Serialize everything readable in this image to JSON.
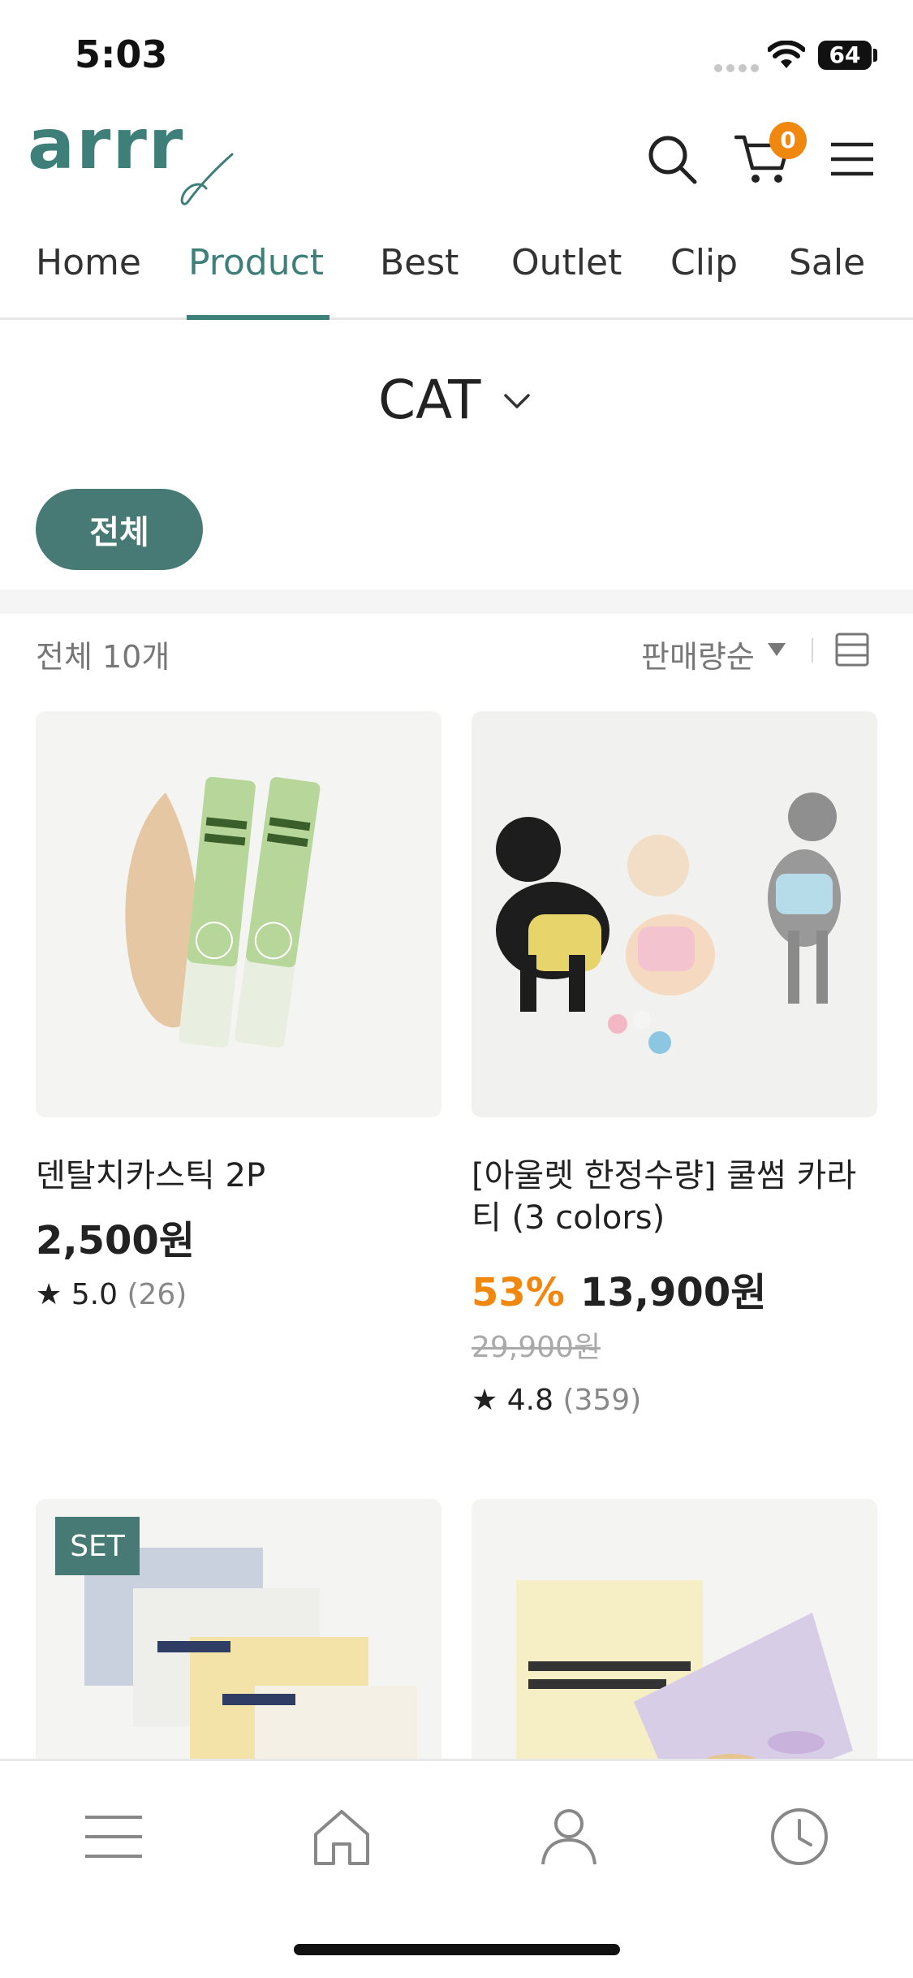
{
  "status_bar": {
    "time": "5:03",
    "battery": "64"
  },
  "header": {
    "logo": "arrr",
    "icons": [
      "search-icon",
      "cart-icon",
      "menu-icon"
    ],
    "cart_count": "0",
    "accent_color": "#3f7f7a",
    "badge_color": "#f0870e"
  },
  "nav": {
    "tabs": [
      {
        "label": "Home"
      },
      {
        "label": "Product"
      },
      {
        "label": "Best"
      },
      {
        "label": "Outlet"
      },
      {
        "label": "Clip"
      },
      {
        "label": "Sale"
      }
    ],
    "active": "Product"
  },
  "category": {
    "title": "CAT",
    "chip": "전체"
  },
  "list": {
    "count": "전체 10개",
    "sort": "판매량순"
  },
  "products": [
    {
      "name": "덴탈치카스틱 2P",
      "price": "2,500원",
      "rating": "5.0",
      "reviews": "(26)"
    },
    {
      "name": "[아울렛 한정수량] 쿨썸 카라티 (3 colors)",
      "discount": "53%",
      "price": "13,900원",
      "original_price": "29,900원",
      "rating": "4.8",
      "reviews": "(359)"
    },
    {
      "badge": "SET"
    },
    {}
  ],
  "bottom_nav": {
    "icons": [
      "menu-icon",
      "home-icon",
      "user-icon",
      "clock-icon"
    ]
  }
}
